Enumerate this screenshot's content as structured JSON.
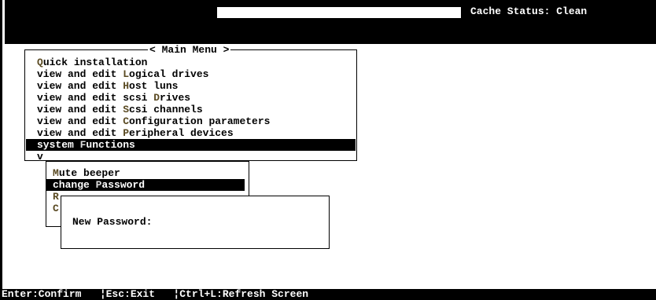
{
  "header": {
    "cache_status": "Cache Status: Clean"
  },
  "main_menu": {
    "title": "< Main Menu >",
    "items": [
      {
        "pre": "",
        "hot": "Q",
        "post": "uick installation"
      },
      {
        "pre": "view and edit ",
        "hot": "L",
        "post": "ogical drives"
      },
      {
        "pre": "view and edit ",
        "hot": "H",
        "post": "ost luns"
      },
      {
        "pre": "view and edit scsi ",
        "hot": "D",
        "post": "rives"
      },
      {
        "pre": "view and edit ",
        "hot": "S",
        "post": "csi channels"
      },
      {
        "pre": "view and edit ",
        "hot": "C",
        "post": "onfiguration parameters"
      },
      {
        "pre": "view and edit ",
        "hot": "P",
        "post": "eripheral devices"
      },
      {
        "pre": "system ",
        "hot": "F",
        "post": "unctions"
      },
      {
        "pre": "v",
        "hot": "",
        "post": ""
      }
    ]
  },
  "submenu": {
    "items": [
      {
        "pre": "",
        "hot": "M",
        "post": "ute beeper"
      },
      {
        "pre": "change ",
        "hot": "P",
        "post": "assword"
      },
      {
        "pre": "",
        "hot": "R",
        "post": ""
      },
      {
        "pre": "",
        "hot": "C",
        "post": ""
      }
    ]
  },
  "password_dialog": {
    "label": "New Password:"
  },
  "status_bar": {
    "text": "Enter:Confirm   ¦Esc:Exit   ¦Ctrl+L:Refresh Screen"
  }
}
